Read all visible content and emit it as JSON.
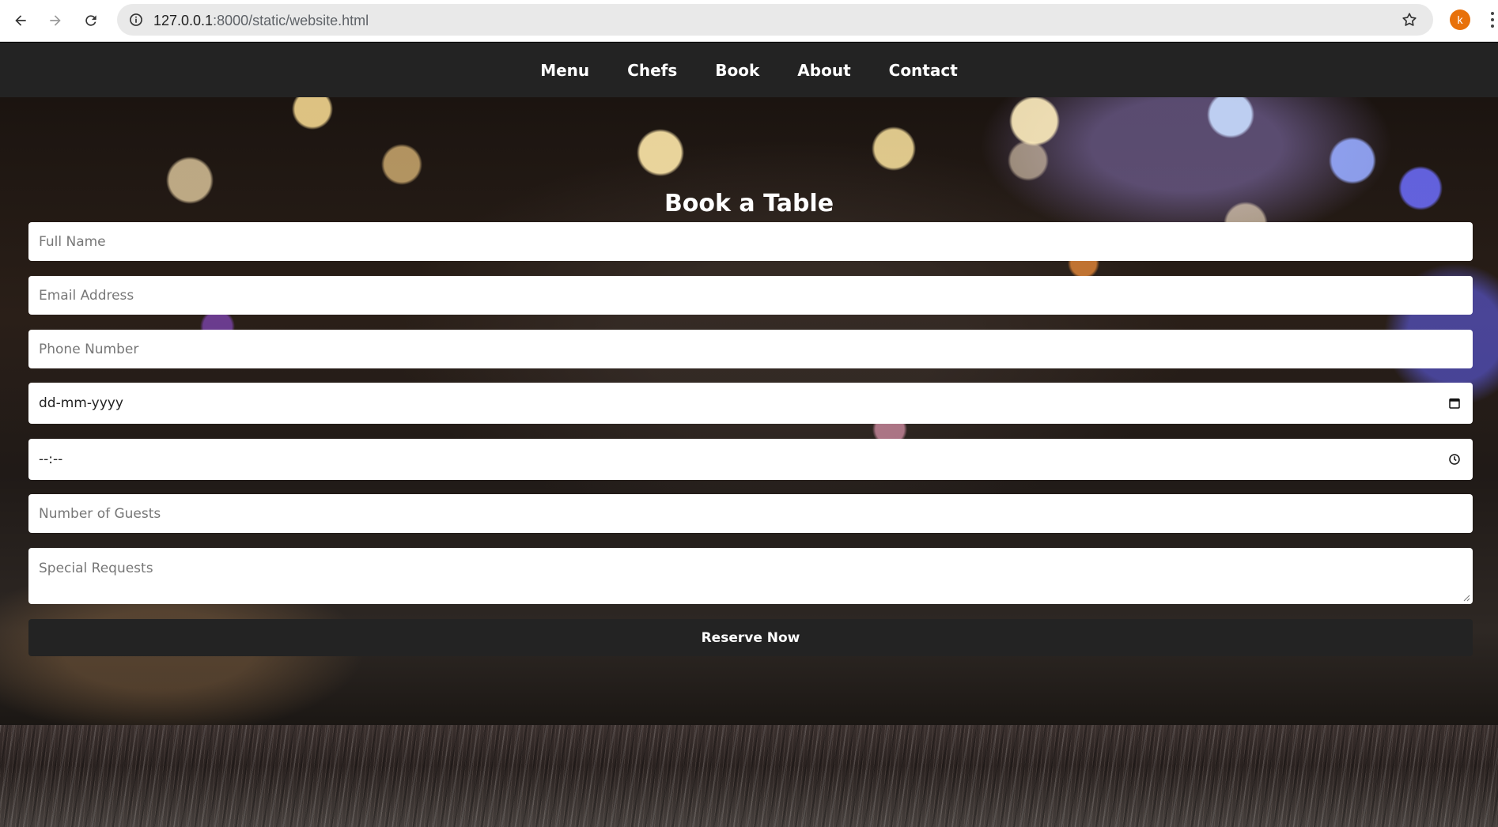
{
  "browser": {
    "url_host": "127.0.0.1",
    "url_rest": ":8000/static/website.html",
    "profile_initial": "k"
  },
  "nav": {
    "items": [
      "Menu",
      "Chefs",
      "Book",
      "About",
      "Contact"
    ]
  },
  "booking": {
    "title": "Book a Table",
    "fields": {
      "name_placeholder": "Full Name",
      "email_placeholder": "Email Address",
      "phone_placeholder": "Phone Number",
      "date_value": "dd-mm-yyyy",
      "time_value": "--:--",
      "guests_placeholder": "Number of Guests",
      "requests_placeholder": "Special Requests"
    },
    "submit_label": "Reserve Now"
  },
  "colors": {
    "navbar": "#232323",
    "button": "#232323",
    "profile": "#e8710a"
  }
}
